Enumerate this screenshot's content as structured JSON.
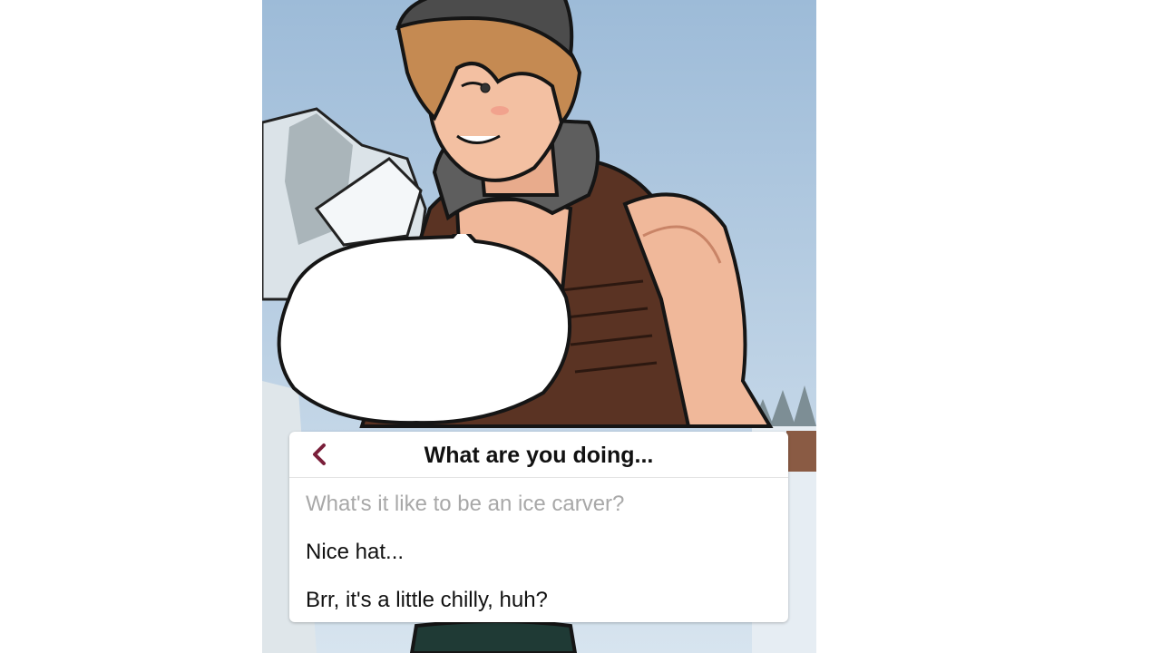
{
  "dialogue": {
    "title": "What are you doing...",
    "back_icon": "chevron-left-icon",
    "options": [
      {
        "label": "What's it like to be an ice carver?",
        "state": "used"
      },
      {
        "label": "Nice hat...",
        "state": "available"
      },
      {
        "label": "Brr, it's a little chilly, huh?",
        "state": "available"
      }
    ]
  },
  "speech_bubble": {
    "text": ""
  },
  "colors": {
    "accent": "#7a1f3a",
    "sky": "#a9c3dc",
    "snow": "#e8eef4",
    "vest": "#5a3323",
    "skin": "#f0b89a",
    "hair": "#c58a52",
    "beanie": "#4c4c4c"
  }
}
